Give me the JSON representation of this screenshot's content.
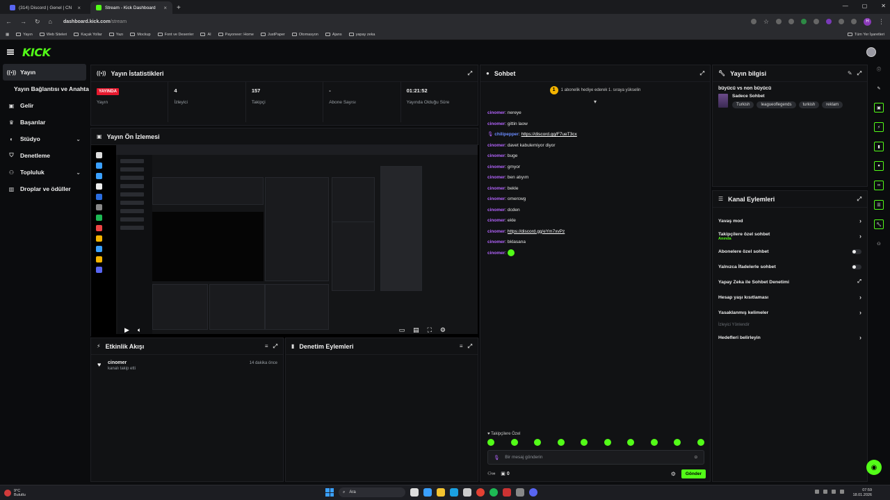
{
  "browser": {
    "tabs": [
      {
        "title": "(314) Discord | Genel | CN",
        "active": false,
        "color": "#5865f2"
      },
      {
        "title": "Stream - Kick Dashboard",
        "active": true,
        "color": "#53fc18"
      }
    ],
    "url_host": "dashboard.kick.com",
    "url_path": "/stream",
    "profile_initial": "H",
    "bookmarks": [
      "Yayın",
      "Web Siteleri",
      "Kaçak Yollar",
      "Yazı",
      "Mockup",
      "Font ve Desenler",
      "AI",
      "Payoneer: Home",
      "JustPaper",
      "Otomasyon",
      "Ajans",
      "yapay zeka"
    ],
    "bookmarks_right": "Tüm Yer İşaretleri"
  },
  "brand": {
    "logo": "KICK",
    "accent": "#53fc18"
  },
  "sidebar": {
    "items": [
      {
        "label": "Yayın",
        "icon": "broadcast-icon"
      },
      {
        "label": "Yayın Bağlantısı ve Anahtarı",
        "icon": ""
      },
      {
        "label": "Gelir",
        "icon": "wallet-icon"
      },
      {
        "label": "Başarılar",
        "icon": "trophy-icon"
      },
      {
        "label": "Stüdyo",
        "icon": "studio-icon"
      },
      {
        "label": "Denetleme",
        "icon": "shield-icon"
      },
      {
        "label": "Topluluk",
        "icon": "community-icon"
      },
      {
        "label": "Droplar ve ödüller",
        "icon": "gift-icon"
      }
    ]
  },
  "stats": {
    "title": "Yayın İstatistikleri",
    "live_badge": "YAYINDA",
    "live_label": "Yayın",
    "viewers": "4",
    "viewers_label": "İzleyici",
    "followers": "157",
    "followers_label": "Takipçi",
    "subs": "-",
    "subs_label": "Abone Sayısı",
    "duration": "01:21:52",
    "duration_label": "Yayında Olduğu Süre"
  },
  "preview": {
    "title": "Yayın Ön İzlemesi"
  },
  "activity": {
    "title": "Etkinlik Akışı",
    "events": [
      {
        "user": "cinomer",
        "desc": "kanalı takip etti",
        "time": "14 dakika önce"
      }
    ]
  },
  "modlog": {
    "title": "Denetim Eylemleri"
  },
  "chat": {
    "title": "Sohbet",
    "gift_text": "1 abonelik hediye ederek 1. sıraya yükselin",
    "messages": [
      {
        "user": "cinomer",
        "text": "nereye"
      },
      {
        "user": "cinomer",
        "text": "gittin laow"
      },
      {
        "user": "chilipepper",
        "text": "https://discord.gg/F7ueT3cx",
        "link": true,
        "special": true
      },
      {
        "user": "cinomer",
        "text": "davet kabulemiyor diyor"
      },
      {
        "user": "cinomer",
        "text": "buge"
      },
      {
        "user": "cinomer",
        "text": "gmyor"
      },
      {
        "user": "cinomer",
        "text": "ben atıyım"
      },
      {
        "user": "cinomer",
        "text": "bekle"
      },
      {
        "user": "cinomer",
        "text": "omercwg"
      },
      {
        "user": "cinomer",
        "text": "dcden"
      },
      {
        "user": "cinomer",
        "text": "ekle"
      },
      {
        "user": "cinomer",
        "text": "https://discord.gg/eYm7xvPz",
        "link": true
      },
      {
        "user": "cinomer",
        "text": "bklasana"
      },
      {
        "user": "cinomer",
        "text": ""
      }
    ],
    "follower_only": "Takipçilere Özel",
    "input_placeholder": "Bir mesaj gönderin",
    "counter_a": "0",
    "send_label": "Gönder"
  },
  "stream_info": {
    "title": "Yayın bilgisi",
    "stream_title": "büyücü vs non büyücü",
    "category": "Sadece Sohbet",
    "tags": [
      "Turkish",
      "leagueoflegends",
      "turkish",
      "reklam"
    ]
  },
  "channel_actions": {
    "title": "Kanal Eylemleri",
    "rows": [
      {
        "label": "Yavaş mod",
        "type": "chevron"
      },
      {
        "label": "Takipçilere özel sohbet",
        "sub": "Anında",
        "type": "chevron"
      },
      {
        "label": "Abonelere özel sohbet",
        "type": "toggle"
      },
      {
        "label": "Yalnızca İfadelerle sohbet",
        "type": "toggle"
      },
      {
        "label": "Yapay Zeka ile Sohbet Denetimi",
        "type": "ext"
      },
      {
        "label": "Hesap yaşı kısıtlaması",
        "type": "chevron"
      },
      {
        "label": "Yasaklanmış kelimeler",
        "type": "chevron"
      }
    ],
    "section": "İzleyici Yönlendir",
    "goals": "Hedefleri belirleyin"
  },
  "taskbar": {
    "temp": "9°C",
    "weather": "Bulutlu",
    "search": "Ara",
    "time": "07:59",
    "date": "18.01.2026"
  }
}
